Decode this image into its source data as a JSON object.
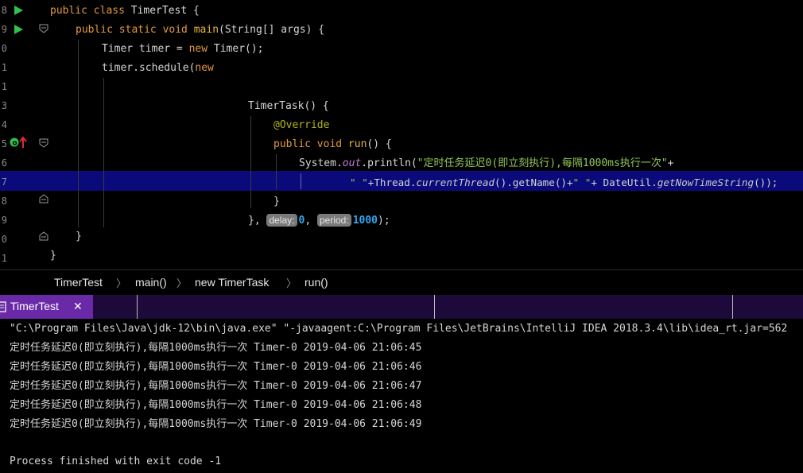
{
  "editor": {
    "line_numbers": [
      "8",
      "9",
      "0",
      "1",
      "1",
      "3",
      "4",
      "5",
      "6",
      "7",
      "8",
      "9",
      "0",
      "1"
    ],
    "code": {
      "l1": {
        "kw": "public class ",
        "name": "TimerTest",
        "rest": " {"
      },
      "l2": {
        "kw": "public static void ",
        "fn": "main",
        "rest": "(String[] args) {"
      },
      "l3": {
        "type": "Timer timer = ",
        "kw": "new ",
        "rest": "Timer();"
      },
      "l4": {
        "pre": "timer.schedule(",
        "kw": "new"
      },
      "l6": {
        "text": "TimerTask() {"
      },
      "l7": {
        "ann": "@Override"
      },
      "l8": {
        "kw": "public void ",
        "fn": "run",
        "rest": "() {"
      },
      "l9": {
        "pre": "System.",
        "field": "out",
        "mid": ".println(",
        "str": "\"定时任务延迟0(即立刻执行),每隔1000ms执行一次\"",
        "rest": "+"
      },
      "l10": {
        "str1": "\" \"",
        "p1": "+Thread.",
        "m1": "currentThread",
        "p2": "().getName()+",
        "str2": "\" \"",
        "p3": "+ DateUtil.",
        "m2": "getNowTimeString",
        "p4": "());"
      },
      "l11": {
        "text": "}"
      },
      "l12": {
        "pre": "}, ",
        "hint1": "delay:",
        "v1": "0",
        "mid": ", ",
        "hint2": "period:",
        "v2": "1000",
        "rest": ");"
      },
      "l13": {
        "text": "}"
      },
      "l14": {
        "text": "}"
      }
    }
  },
  "breadcrumb": [
    "TimerTest",
    "main()",
    "new TimerTask",
    "run()"
  ],
  "breadcrumb_sep": "〉",
  "run_tab": {
    "label": "TimerTest",
    "close": "✕"
  },
  "console": {
    "command": "\"C:\\Program Files\\Java\\jdk-12\\bin\\java.exe\" \"-javaagent:C:\\Program Files\\JetBrains\\IntelliJ IDEA 2018.3.4\\lib\\idea_rt.jar=562",
    "lines": [
      "定时任务延迟0(即立刻执行),每隔1000ms执行一次 Timer-0 2019-04-06 21:06:45",
      "定时任务延迟0(即立刻执行),每隔1000ms执行一次 Timer-0 2019-04-06 21:06:46",
      "定时任务延迟0(即立刻执行),每隔1000ms执行一次 Timer-0 2019-04-06 21:06:47",
      "定时任务延迟0(即立刻执行),每隔1000ms执行一次 Timer-0 2019-04-06 21:06:48",
      "定时任务延迟0(即立刻执行),每隔1000ms执行一次 Timer-0 2019-04-06 21:06:49"
    ],
    "exit": "Process finished with exit code -1"
  },
  "colors": {
    "current_line": "#0a0a7a",
    "run_tab": "#6a2aa8",
    "run_icon": "#2ec24a"
  },
  "icons": [
    "run-gutter-icon",
    "fold-icon",
    "override-marker-icon",
    "run-tool-icon",
    "close-icon"
  ]
}
